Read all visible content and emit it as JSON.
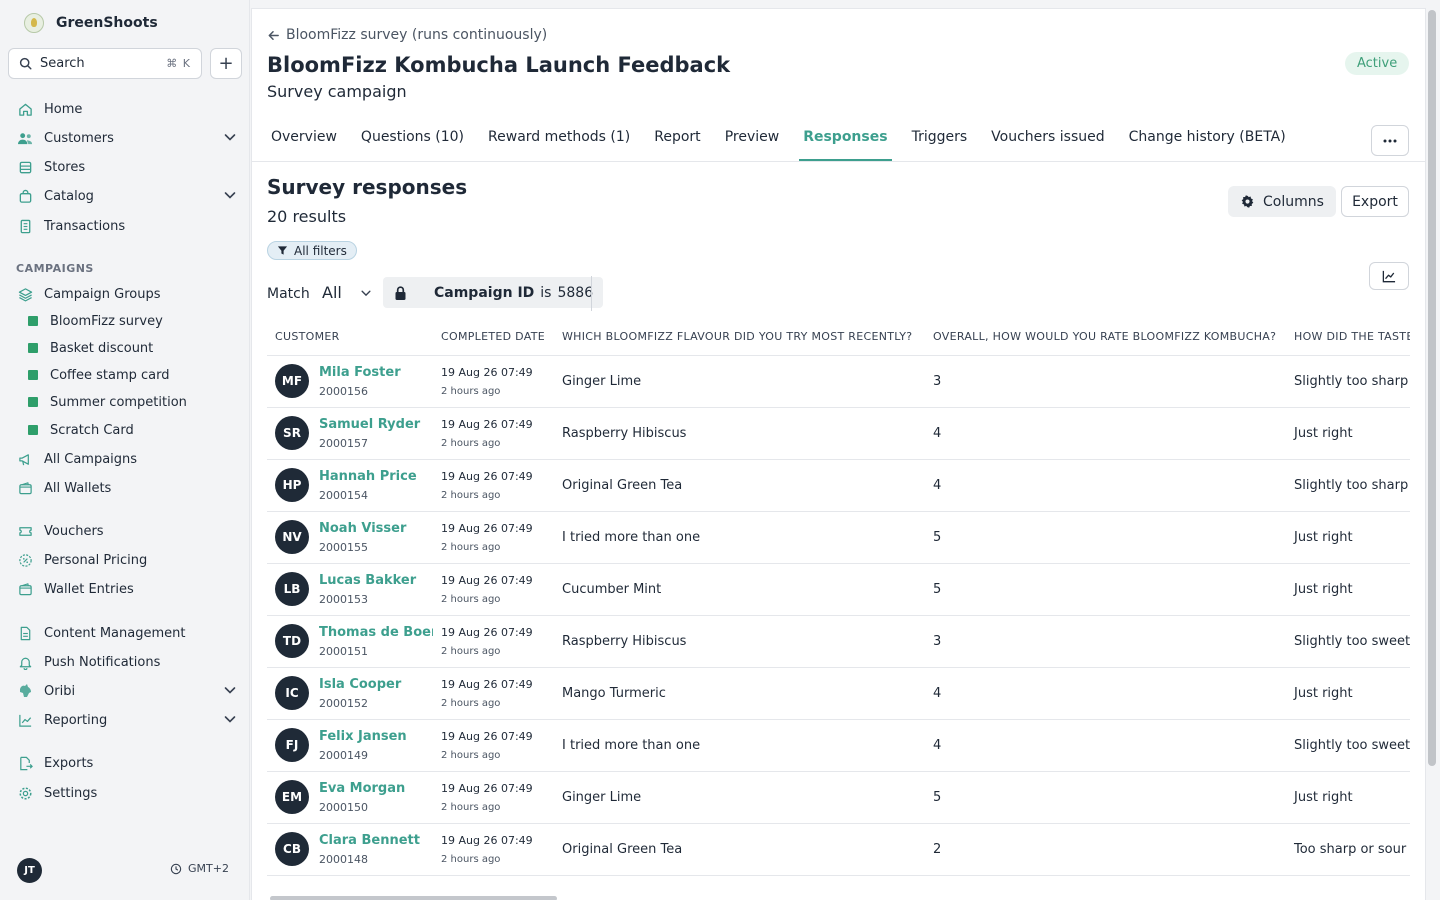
{
  "brand": {
    "name": "GreenShoots"
  },
  "search": {
    "label": "Search",
    "shortcut": "⌘ K"
  },
  "nav": {
    "top": [
      {
        "name": "home",
        "label": "Home",
        "icon": "home-icon",
        "chevron": false
      },
      {
        "name": "customers",
        "label": "Customers",
        "icon": "users-icon",
        "chevron": true
      },
      {
        "name": "stores",
        "label": "Stores",
        "icon": "store-icon",
        "chevron": false
      },
      {
        "name": "catalog",
        "label": "Catalog",
        "icon": "bag-icon",
        "chevron": true
      },
      {
        "name": "transactions",
        "label": "Transactions",
        "icon": "receipt-icon",
        "chevron": false
      }
    ],
    "campaigns_label": "CAMPAIGNS",
    "campaign_groups": "Campaign Groups",
    "sub": [
      "BloomFizz survey",
      "Basket discount",
      "Coffee stamp card",
      "Summer competition",
      "Scratch Card"
    ],
    "all_campaigns": "All Campaigns",
    "all_wallets": "All Wallets",
    "vouchers": "Vouchers",
    "personal_pricing": "Personal Pricing",
    "wallet_entries": "Wallet Entries",
    "content_management": "Content Management",
    "push_notifications": "Push Notifications",
    "oribi": "Oribi",
    "reporting": "Reporting",
    "exports": "Exports",
    "settings": "Settings"
  },
  "user": {
    "initials": "JT",
    "timezone": "GMT+2"
  },
  "header": {
    "back": "BloomFizz survey (runs continuously)",
    "title": "BloomFizz Kombucha Launch Feedback",
    "subtitle": "Survey campaign",
    "status": "Active"
  },
  "tabs": [
    "Overview",
    "Questions (10)",
    "Reward methods (1)",
    "Report",
    "Preview",
    "Responses",
    "Triggers",
    "Vouchers issued",
    "Change history (BETA)"
  ],
  "active_tab": "Responses",
  "section": {
    "title": "Survey responses",
    "count": "20 results",
    "columns": "Columns",
    "export": "Export"
  },
  "filters": {
    "all_filters": "All filters",
    "match_label": "Match",
    "match_value": "All",
    "condition_field": "Campaign ID",
    "condition_op": "is",
    "condition_value": "5886"
  },
  "table": {
    "headers": [
      "CUSTOMER",
      "COMPLETED DATE",
      "WHICH BLOOMFIZZ FLAVOUR DID YOU TRY MOST RECENTLY?",
      "OVERALL, HOW WOULD YOU RATE BLOOMFIZZ KOMBUCHA?",
      "HOW DID THE TASTE"
    ],
    "rows": [
      {
        "initials": "MF",
        "name": "Mila Foster",
        "id": "2000156",
        "date": "19 Aug 26 07:49",
        "ago": "2 hours ago",
        "flavour": "Ginger Lime",
        "rating": "3",
        "taste": "Slightly too sharp"
      },
      {
        "initials": "SR",
        "name": "Samuel Ryder",
        "id": "2000157",
        "date": "19 Aug 26 07:49",
        "ago": "2 hours ago",
        "flavour": "Raspberry Hibiscus",
        "rating": "4",
        "taste": "Just right"
      },
      {
        "initials": "HP",
        "name": "Hannah Price",
        "id": "2000154",
        "date": "19 Aug 26 07:49",
        "ago": "2 hours ago",
        "flavour": "Original Green Tea",
        "rating": "4",
        "taste": "Slightly too sharp"
      },
      {
        "initials": "NV",
        "name": "Noah Visser",
        "id": "2000155",
        "date": "19 Aug 26 07:49",
        "ago": "2 hours ago",
        "flavour": "I tried more than one",
        "rating": "5",
        "taste": "Just right"
      },
      {
        "initials": "LB",
        "name": "Lucas Bakker",
        "id": "2000153",
        "date": "19 Aug 26 07:49",
        "ago": "2 hours ago",
        "flavour": "Cucumber Mint",
        "rating": "5",
        "taste": "Just right"
      },
      {
        "initials": "TD",
        "name": "Thomas de Boer",
        "id": "2000151",
        "date": "19 Aug 26 07:49",
        "ago": "2 hours ago",
        "flavour": "Raspberry Hibiscus",
        "rating": "3",
        "taste": "Slightly too sweet"
      },
      {
        "initials": "IC",
        "name": "Isla Cooper",
        "id": "2000152",
        "date": "19 Aug 26 07:49",
        "ago": "2 hours ago",
        "flavour": "Mango Turmeric",
        "rating": "4",
        "taste": "Just right"
      },
      {
        "initials": "FJ",
        "name": "Felix Jansen",
        "id": "2000149",
        "date": "19 Aug 26 07:49",
        "ago": "2 hours ago",
        "flavour": "I tried more than one",
        "rating": "4",
        "taste": "Slightly too sweet"
      },
      {
        "initials": "EM",
        "name": "Eva Morgan",
        "id": "2000150",
        "date": "19 Aug 26 07:49",
        "ago": "2 hours ago",
        "flavour": "Ginger Lime",
        "rating": "5",
        "taste": "Just right"
      },
      {
        "initials": "CB",
        "name": "Clara Bennett",
        "id": "2000148",
        "date": "19 Aug 26 07:49",
        "ago": "2 hours ago",
        "flavour": "Original Green Tea",
        "rating": "2",
        "taste": "Too sharp or sour"
      }
    ]
  },
  "colors": {
    "accent": "#3d9f8e",
    "avatar": "#1f2a37",
    "campaign_square": "#2e9e6a",
    "active_badge_bg": "#e6f5ee"
  }
}
